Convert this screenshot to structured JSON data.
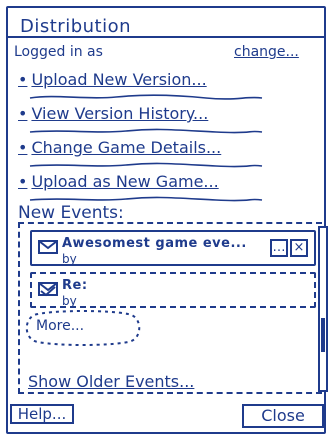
{
  "window": {
    "title": "Distribution"
  },
  "user": {
    "logged_in_prefix": "Logged in as",
    "name": "",
    "change_label": "change..."
  },
  "actions": [
    {
      "label": "Upload New Version..."
    },
    {
      "label": "View Version History..."
    },
    {
      "label": "Change Game Details..."
    },
    {
      "label": "Upload as New Game..."
    }
  ],
  "events": {
    "section_title": "New Events:",
    "items": [
      {
        "title": "Awesomest game eve...",
        "by": "by"
      },
      {
        "title": "Re:",
        "by": "by"
      }
    ],
    "more_label": "More...",
    "older_label": "Show Older Events..."
  },
  "buttons": {
    "help": "Help...",
    "close": "Close"
  }
}
